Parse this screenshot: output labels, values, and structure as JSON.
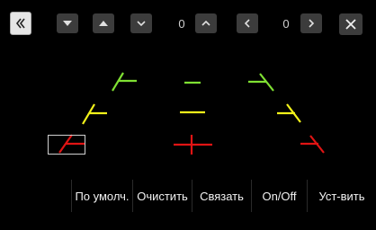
{
  "toolbar": {
    "back_icon": "double-chevron-left-icon",
    "vertical_down_icon": "triangle-down-icon",
    "vertical_up_icon": "triangle-up-icon",
    "row_down_icon": "chevron-down-icon",
    "row_counter": "0",
    "row_up_icon": "chevron-up-icon",
    "col_left_icon": "chevron-left-icon",
    "col_counter": "0",
    "col_right_icon": "chevron-right-icon",
    "close_icon": "close-icon"
  },
  "guide_colors": {
    "far": "#7fe033",
    "middle": "#f2f21a",
    "near": "#e01414"
  },
  "bottom_buttons": [
    {
      "label": "По умолч."
    },
    {
      "label": "Очистить"
    },
    {
      "label": "Связать"
    },
    {
      "label": "On/Off"
    },
    {
      "label": "Уст-вить"
    }
  ]
}
